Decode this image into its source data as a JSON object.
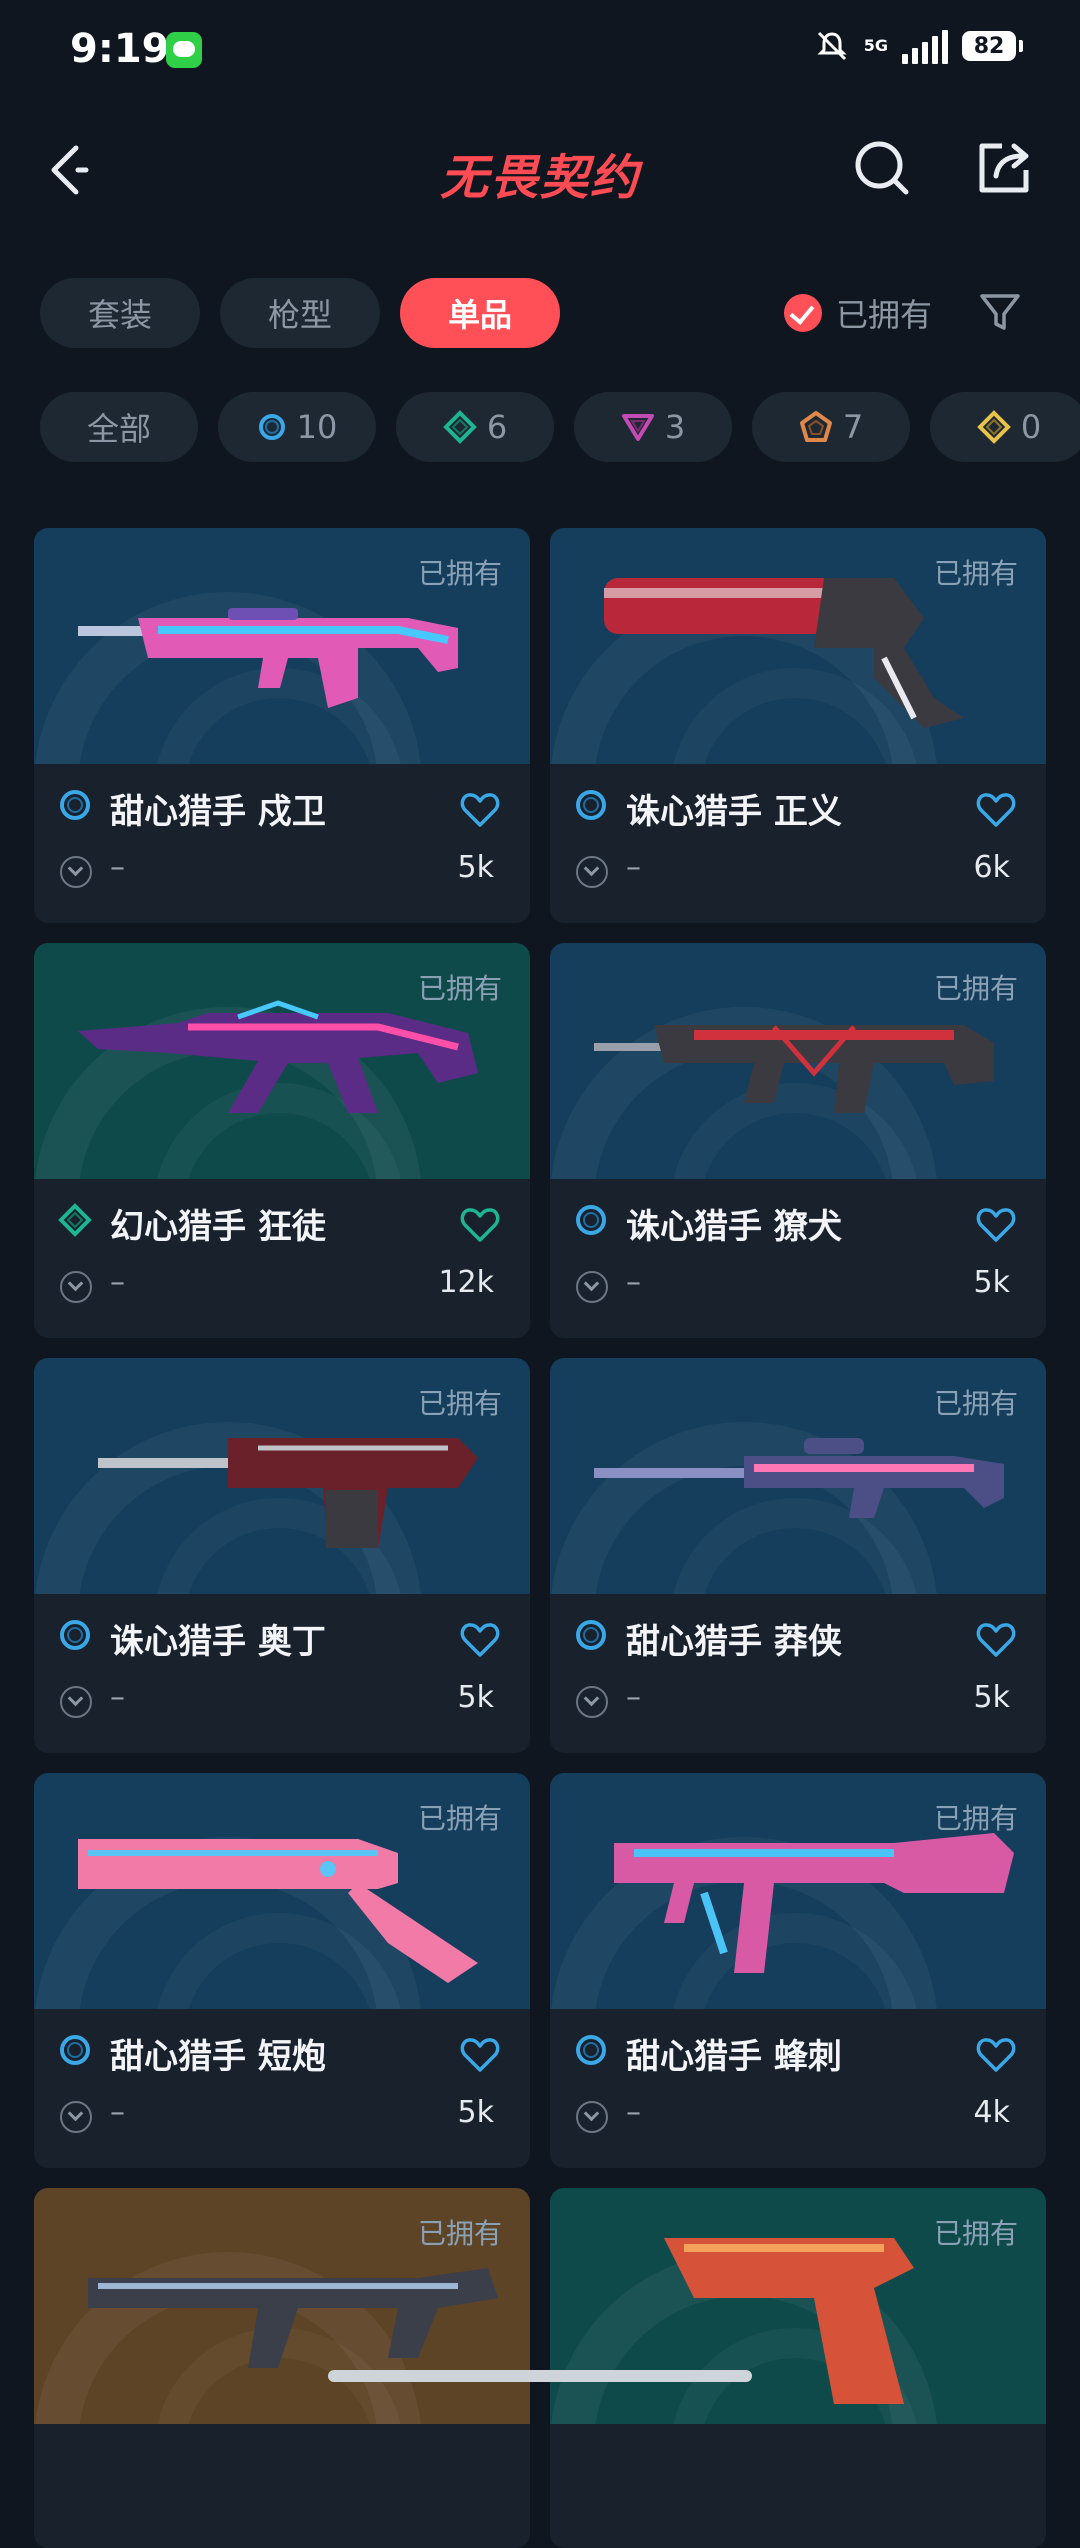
{
  "status": {
    "time": "9:19",
    "network": "5G",
    "battery": "82"
  },
  "header": {
    "title": "无畏契约"
  },
  "tabs": [
    {
      "label": "套装",
      "active": false
    },
    {
      "label": "枪型",
      "active": false
    },
    {
      "label": "单品",
      "active": true
    }
  ],
  "owned_filter": {
    "label": "已拥有",
    "checked": true
  },
  "rarity_chips": [
    {
      "label": "全部",
      "icon": "",
      "color": ""
    },
    {
      "label": "10",
      "icon": "circle-tier-icon",
      "color": "#3aa7e6"
    },
    {
      "label": "6",
      "icon": "diamond-tier-icon",
      "color": "#1fb593"
    },
    {
      "label": "3",
      "icon": "triangle-tier-icon",
      "color": "#c44bb3"
    },
    {
      "label": "7",
      "icon": "pentagon-tier-icon",
      "color": "#e0874a"
    },
    {
      "label": "0",
      "icon": "diamond-tier-icon",
      "color": "#e8c24a"
    }
  ],
  "cards": [
    {
      "name": "甜心猎手 戍卫",
      "owned": "已拥有",
      "level": "–",
      "likes": "5k",
      "tier": "circle",
      "bg": "blue",
      "gun_color": "#e05ab6",
      "accent": "#47c8ff"
    },
    {
      "name": "诛心猎手 正义",
      "owned": "已拥有",
      "level": "–",
      "likes": "6k",
      "tier": "circle",
      "bg": "blue",
      "gun_color": "#b8283a",
      "accent": "#e9e9ef"
    },
    {
      "name": "幻心猎手 狂徒",
      "owned": "已拥有",
      "level": "–",
      "likes": "12k",
      "tier": "diamond",
      "bg": "green",
      "gun_color": "#5a2c86",
      "accent": "#ff4fa8"
    },
    {
      "name": "诛心猎手 獠犬",
      "owned": "已拥有",
      "level": "–",
      "likes": "5k",
      "tier": "circle",
      "bg": "blue",
      "gun_color": "#3a3a40",
      "accent": "#d1303d"
    },
    {
      "name": "诛心猎手 奥丁",
      "owned": "已拥有",
      "level": "–",
      "likes": "5k",
      "tier": "circle",
      "bg": "blue",
      "gun_color": "#6a2129",
      "accent": "#bfc3ca"
    },
    {
      "name": "甜心猎手 莽侠",
      "owned": "已拥有",
      "level": "–",
      "likes": "5k",
      "tier": "circle",
      "bg": "blue",
      "gun_color": "#4b4f86",
      "accent": "#ff78b5"
    },
    {
      "name": "甜心猎手 短炮",
      "owned": "已拥有",
      "level": "–",
      "likes": "5k",
      "tier": "circle",
      "bg": "blue",
      "gun_color": "#f27aa7",
      "accent": "#5ac4f5"
    },
    {
      "name": "甜心猎手 蜂刺",
      "owned": "已拥有",
      "level": "–",
      "likes": "4k",
      "tier": "circle",
      "bg": "blue",
      "gun_color": "#d95aa4",
      "accent": "#4ac3f7"
    },
    {
      "name": "",
      "owned": "已拥有",
      "level": "",
      "likes": "",
      "tier": "",
      "bg": "brown",
      "gun_color": "#3b3f4a",
      "accent": "#9fb7d6"
    },
    {
      "name": "",
      "owned": "已拥有",
      "level": "",
      "likes": "",
      "tier": "",
      "bg": "green",
      "gun_color": "#d6533a",
      "accent": "#f2a25a"
    }
  ]
}
